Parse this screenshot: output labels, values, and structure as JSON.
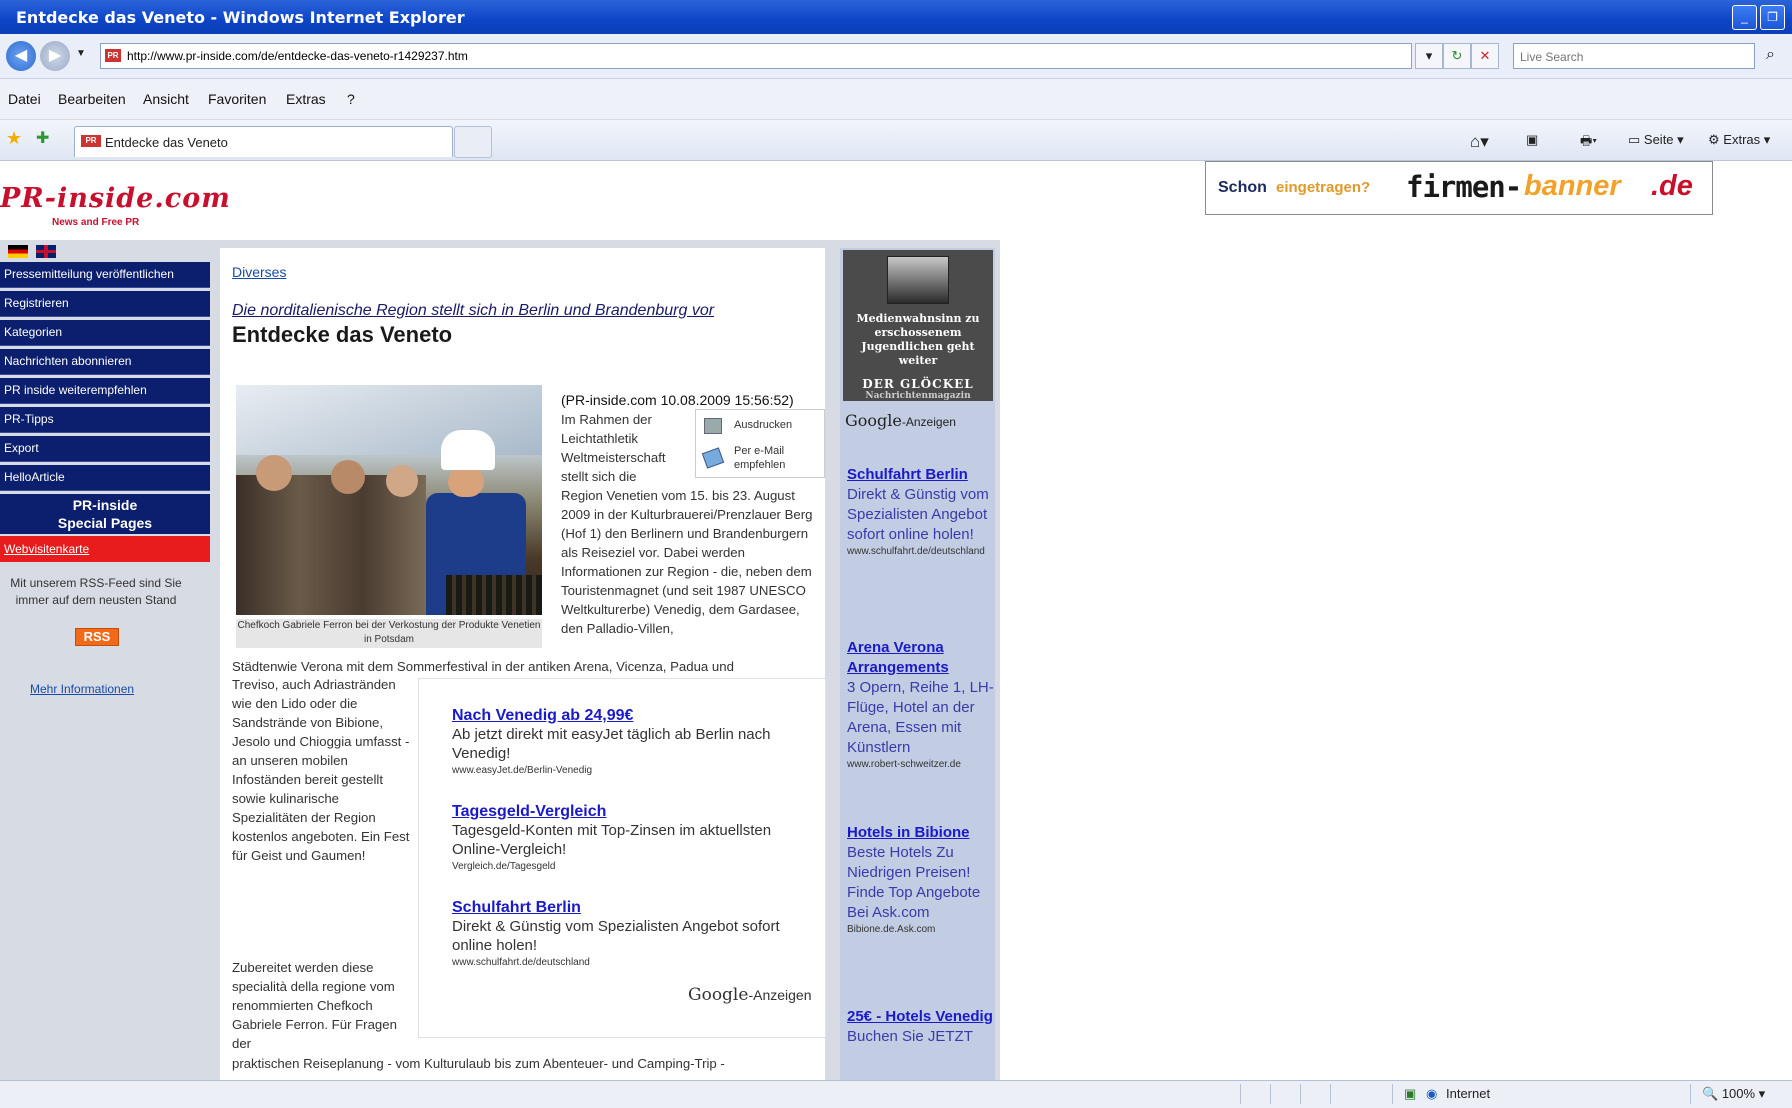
{
  "window": {
    "title": "Entdecke das Veneto - Windows Internet Explorer",
    "controls": [
      "minimize-icon",
      "maximize-icon"
    ]
  },
  "addressbar": {
    "url": "http://www.pr-inside.com/de/entdecke-das-veneto-r1429237.htm",
    "search_placeholder": "Live Search"
  },
  "menubar": [
    "Datei",
    "Bearbeiten",
    "Ansicht",
    "Favoriten",
    "Extras",
    "?"
  ],
  "tabs": [
    {
      "label": "Entdecke das Veneto"
    }
  ],
  "toolbar": {
    "page_label": "Seite",
    "extras_label": "Extras"
  },
  "site": {
    "logo": "PR-inside.com",
    "tagline": "News and Free PR"
  },
  "banner": {
    "part1": "Schon",
    "part2": "eingetragen?",
    "part3": "firmen-",
    "part4": "banner",
    "part5": ".de"
  },
  "sidebar": {
    "items": [
      "Pressemitteilung veröffentlichen",
      "Registrieren",
      "Kategorien",
      "Nachrichten abonnieren",
      "PR inside weiterempfehlen",
      "PR-Tipps",
      "Export",
      "HelloArticle"
    ],
    "special_line1": "PR-inside",
    "special_line2": "Special Pages",
    "vcard": "Webvisitenkarte",
    "rss_text": "Mit unserem RSS-Feed sind Sie immer auf dem neusten Stand",
    "rss_button": "RSS",
    "more_info": "Mehr Informationen"
  },
  "article": {
    "category": "Diverses",
    "subtitle": "Die norditalienische Region stellt sich in Berlin und Brandenburg vor",
    "headline": "Entdecke das Veneto",
    "photo_caption": "Chefkoch Gabriele Ferron bei der Verkostung der Produkte Venetien in Potsdam",
    "print_label": "Ausdrucken",
    "email_label": "Per e-Mail empfehlen",
    "source_line": "(PR-inside.com 10.08.2009 15:56:52)",
    "p1": "Im Rahmen der Leichtathletik Weltmeisterschaft stellt sich die",
    "p2": "Region Venetien vom 15. bis 23. August 2009 in der Kulturbrauerei/Prenzlauer Berg (Hof 1) den Berlinern und Brandenburgern als Reiseziel vor. Dabei werden Informationen zur Region - die, neben dem Touristenmagnet (und seit 1987 UNESCO Weltkulturerbe) Venedig, dem Gardasee, den Palladio-Villen,",
    "p3": "Städtenwie Verona mit dem Sommerfestival in der antiken Arena, Vicenza, Padua und",
    "p4": "Treviso, auch Adriastränden wie den Lido oder die Sandstrände von Bibione, Jesolo und Chioggia umfasst - an unseren mobilen Infoständen bereit gestellt sowie kulinarische Spezialitäten der Region kostenlos angeboten. Ein Fest für Geist und Gaumen!",
    "p5": "Zubereitet werden diese specialità della regione vom renommierten Chefkoch Gabriele Ferron. Für Fragen der",
    "p6": "praktischen Reiseplanung - vom Kulturulaub bis zum Abenteuer- und Camping-Trip -"
  },
  "inline_ads": [
    {
      "title": "Nach Venedig ab 24,99€",
      "desc": "Ab jetzt direkt mit easyJet täglich ab Berlin nach Venedig!",
      "url": "www.easyJet.de/Berlin-Venedig"
    },
    {
      "title": "Tagesgeld-Vergleich",
      "desc": "Tagesgeld-Konten mit Top-Zinsen im aktuellsten Online-Vergleich!",
      "url": "Vergleich.de/Tagesgeld"
    },
    {
      "title": "Schulfahrt Berlin",
      "desc": "Direkt & Günstig vom Spezialisten Angebot sofort online holen!",
      "url": "www.schulfahrt.de/deutschland"
    }
  ],
  "google_ads_label": {
    "brand": "Google",
    "suffix": "-Anzeigen"
  },
  "promo": {
    "text": "Medienwahnsinn zu erschossenem Jugendlichen geht weiter",
    "org": "DER GLÖCKEL",
    "org_sub": "Nachrichtenmagazin"
  },
  "right_ads": [
    {
      "title": "Schulfahrt Berlin",
      "desc": "Direkt & Günstig vom Spezialisten Angebot sofort online holen!",
      "url": "www.schulfahrt.de/deutschland"
    },
    {
      "title": "Arena Verona Arrangements",
      "desc": "3 Opern, Reihe 1, LH-Flüge, Hotel an der Arena, Essen mit Künstlern",
      "url": "www.robert-schweitzer.de"
    },
    {
      "title": "Hotels in Bibione",
      "desc": "Beste Hotels Zu Niedrigen Preisen! Finde Top Angebote Bei Ask.com",
      "url": "Bibione.de.Ask.com"
    },
    {
      "title": "25€ - Hotels Venedig",
      "desc": "Buchen Sie JETZT",
      "url": ""
    }
  ],
  "statusbar": {
    "zone": "Internet",
    "zoom": "100%"
  },
  "colors": {
    "nav_bg": "#0b1f6e",
    "vcard_bg": "#e81c1c",
    "right_col": "#c2cde3",
    "link": "#1a1ac8"
  }
}
